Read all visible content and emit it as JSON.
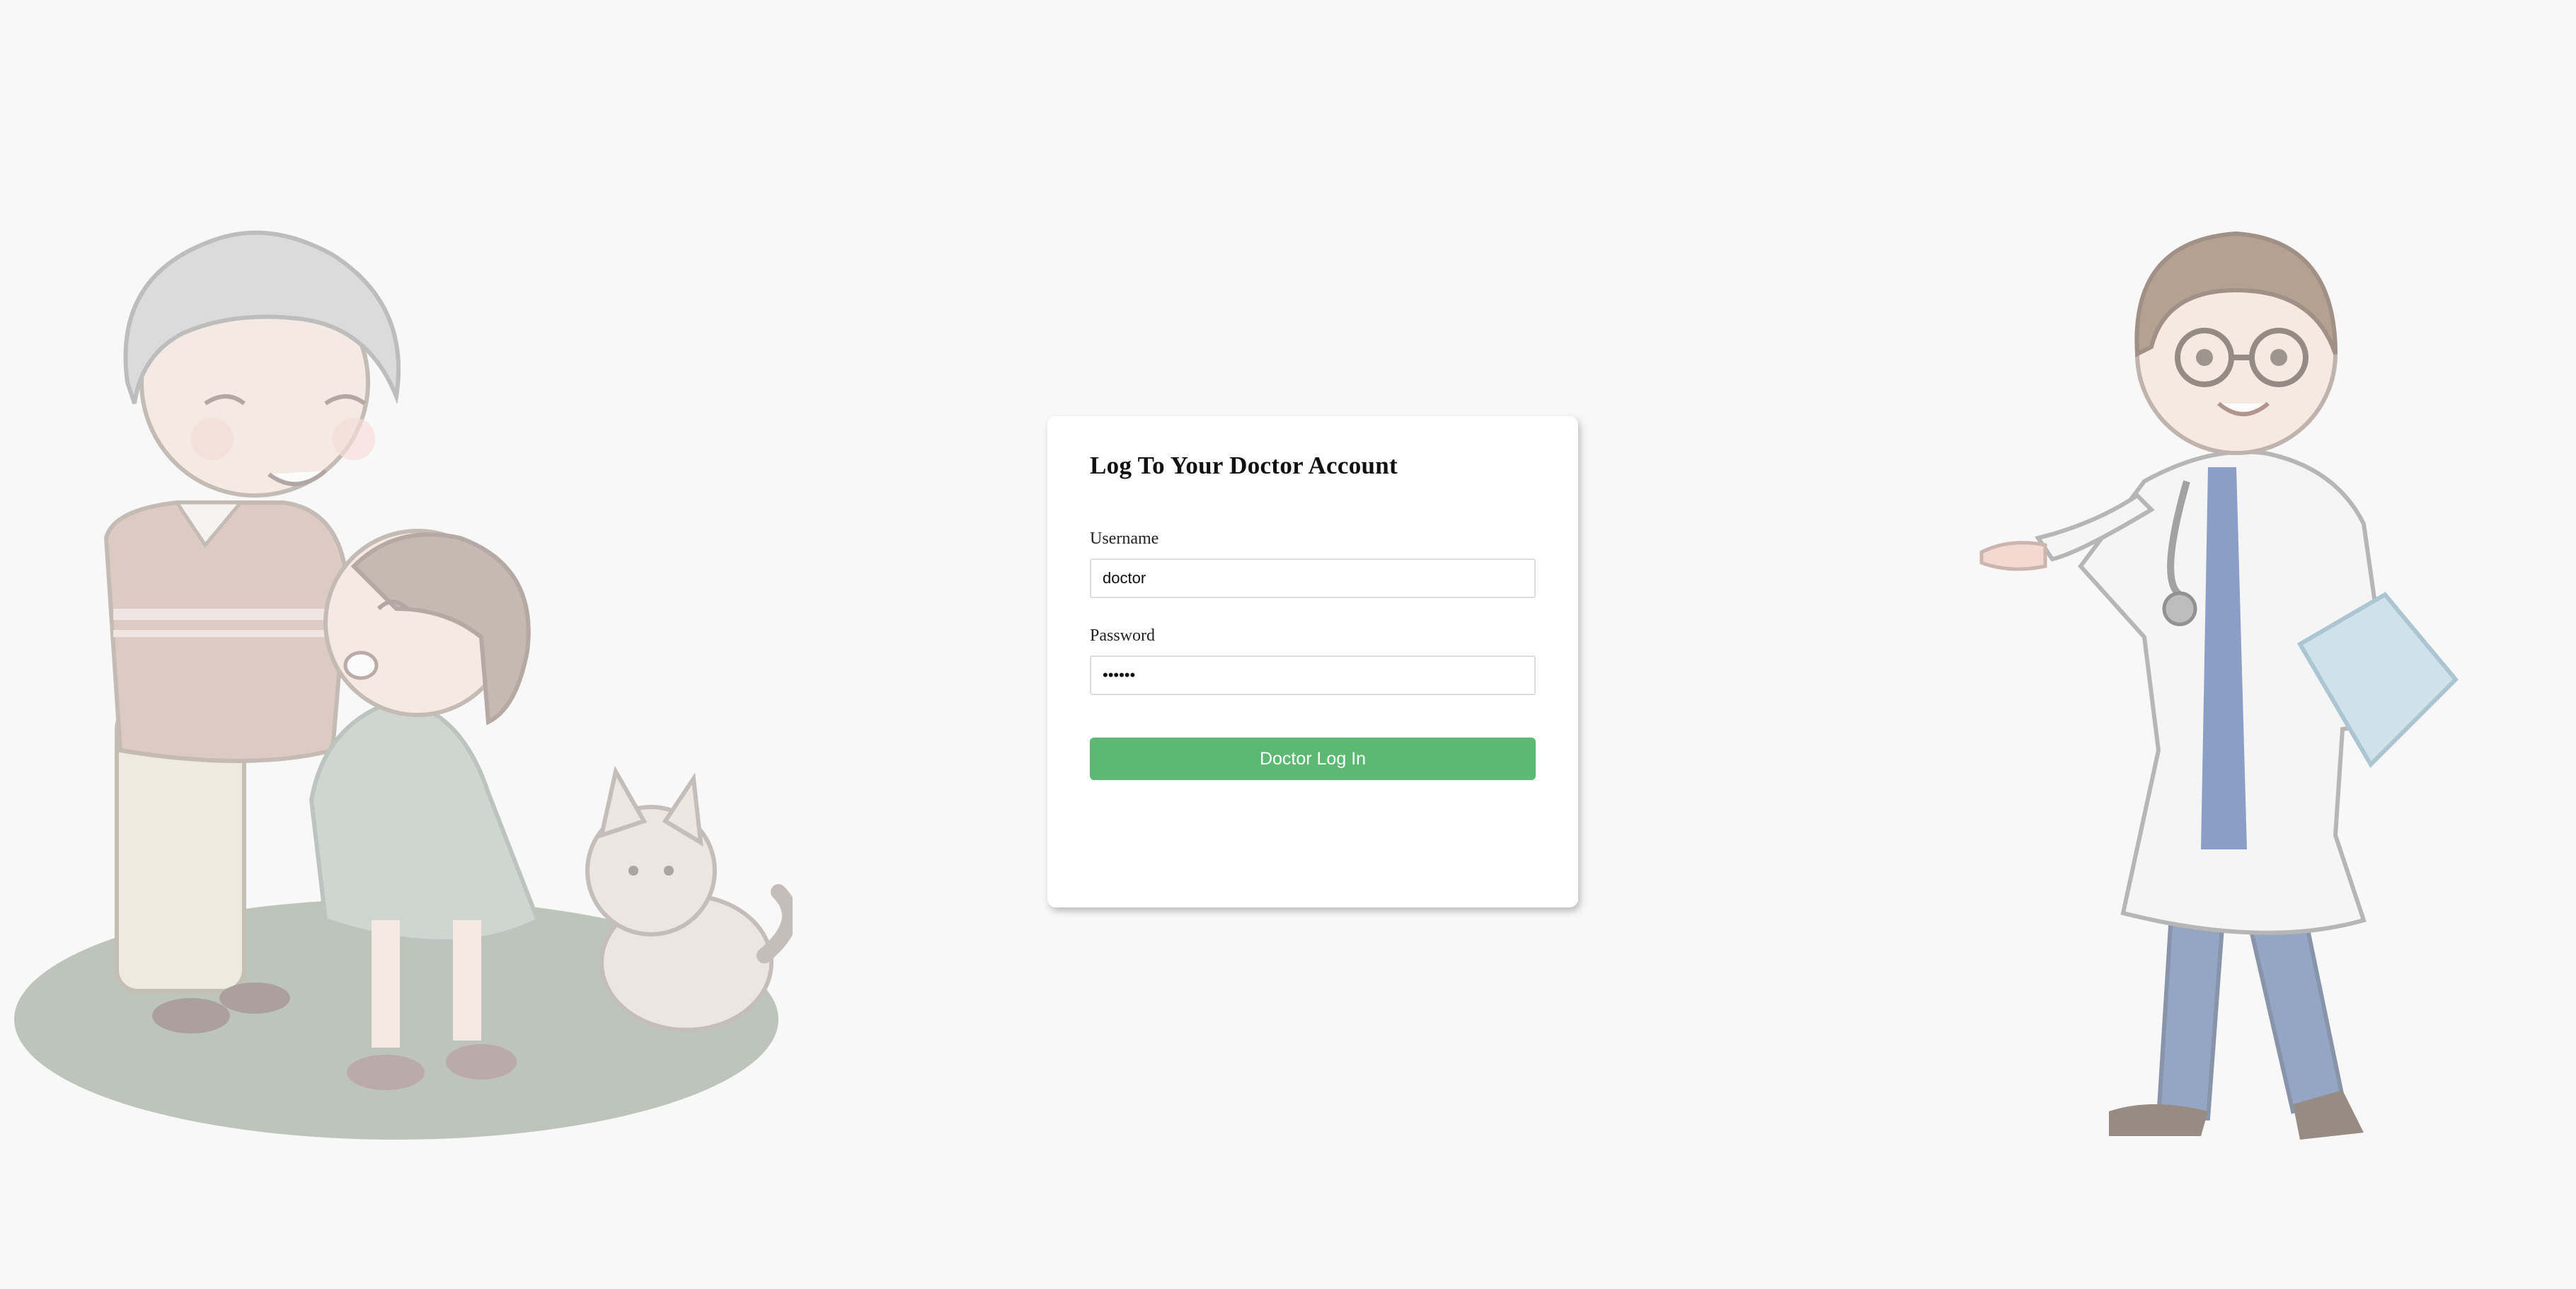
{
  "login": {
    "title": "Log To Your Doctor Account",
    "username_label": "Username",
    "username_value": "doctor",
    "password_label": "Password",
    "password_value": "••••••",
    "submit_label": "Doctor Log In"
  },
  "colors": {
    "background": "#f8f8f8",
    "card": "#ffffff",
    "button": "#5cb872",
    "button_text": "#ffffff"
  },
  "illustrations": {
    "left": "grandmother-child-cat-illustration",
    "right": "doctor-illustration"
  }
}
